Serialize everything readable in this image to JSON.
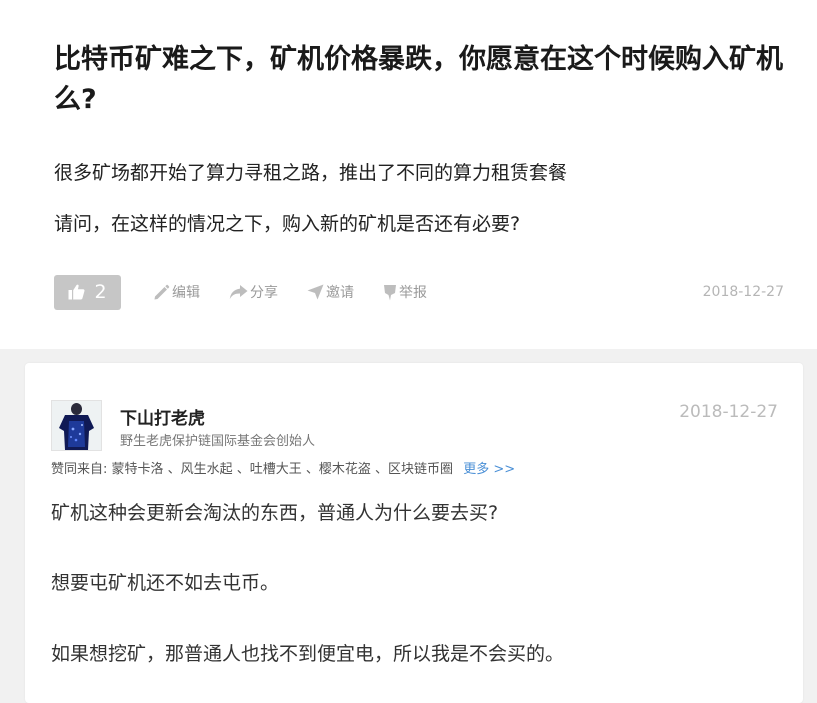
{
  "question": {
    "title": "比特币矿难之下，矿机价格暴跌，你愿意在这个时候购入矿机么?",
    "paragraphs": [
      "很多矿场都开始了算力寻租之路，推出了不同的算力租赁套餐",
      "请问，在这样的情况之下，购入新的矿机是否还有必要?"
    ],
    "like_count": "2",
    "actions": {
      "edit": "编辑",
      "share": "分享",
      "invite": "邀请",
      "report": "举报"
    },
    "date": "2018-12-27"
  },
  "answer": {
    "author_name": "下山打老虎",
    "author_bio": "野生老虎保护链国际基金会创始人",
    "date": "2018-12-27",
    "upvoters_label": "赞同来自:",
    "upvoters_names": "蒙特卡洛 、风生水起 、吐槽大王 、樱木花盗 、区块链币圈",
    "more_label": "更多 >>",
    "paragraphs": [
      "矿机这种会更新会淘汰的东西，普通人为什么要去买?",
      "想要屯矿机还不如去屯币。",
      "如果想挖矿，那普通人也找不到便宜电，所以我是不会买的。"
    ]
  },
  "icons": {
    "like": "thumbs-up-icon",
    "edit": "pencil-icon",
    "share": "share-arrow-icon",
    "invite": "paper-plane-icon",
    "report": "flag-icon"
  },
  "colors": {
    "like_button_bg": "#c6c6c6",
    "link_blue": "#4a8fd6",
    "muted_text": "#9a9a9a",
    "page_bg": "#f1f1f1"
  }
}
